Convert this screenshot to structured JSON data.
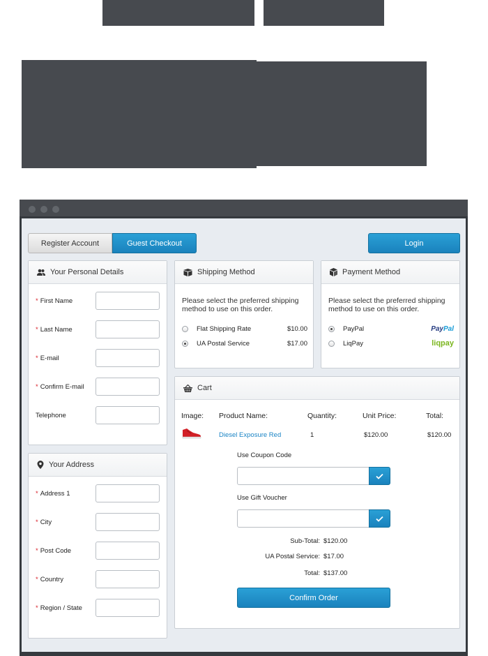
{
  "header": {
    "register_tab": "Register Account",
    "guest_tab": "Guest Checkout",
    "login_button": "Login"
  },
  "personal": {
    "title": "Your Personal Details",
    "fields": [
      {
        "label": "First Name",
        "required": true
      },
      {
        "label": "Last Name",
        "required": true
      },
      {
        "label": "E-mail",
        "required": true
      },
      {
        "label": "Confirm E-mail",
        "required": true
      },
      {
        "label": "Telephone",
        "required": false
      }
    ]
  },
  "address": {
    "title": "Your Address",
    "fields": [
      {
        "label": "Address 1",
        "required": true
      },
      {
        "label": "City",
        "required": true
      },
      {
        "label": "Post Code",
        "required": true
      },
      {
        "label": "Country",
        "required": true
      },
      {
        "label": "Region / State",
        "required": true
      }
    ]
  },
  "shipping": {
    "title": "Shipping Method",
    "description": "Please select the preferred shipping method to use on this order.",
    "options": [
      {
        "label": "Flat Shipping Rate",
        "price": "$10.00",
        "selected": false
      },
      {
        "label": "UA Postal Service",
        "price": "$17.00",
        "selected": true
      }
    ]
  },
  "payment": {
    "title": "Payment Method",
    "description": "Please select the preferred shipping method to use on this order.",
    "options": [
      {
        "label": "PayPal",
        "logo": "PayPal",
        "selected": true
      },
      {
        "label": "LiqPay",
        "logo": "liqpay",
        "selected": false
      }
    ]
  },
  "cart": {
    "title": "Cart",
    "columns": [
      "Image:",
      "Product Name:",
      "Quantity:",
      "Unit Price:",
      "Total:"
    ],
    "items": [
      {
        "name": "Diesel Exposure Red",
        "quantity": "1",
        "unit_price": "$120.00",
        "total": "$120.00"
      }
    ],
    "coupon_label": "Use Coupon Code",
    "voucher_label": "Use Gift Voucher",
    "totals": [
      {
        "label": "Sub-Total:",
        "value": "$120.00"
      },
      {
        "label": "UA Postal Service:",
        "value": "$17.00"
      },
      {
        "label": "Total:",
        "value": "$137.00"
      }
    ],
    "confirm_button": "Confirm Order"
  },
  "colors": {
    "accent": "#1f8fca",
    "required": "#d9232d",
    "frame": "#474a4f",
    "background": "#e8ecf1"
  }
}
